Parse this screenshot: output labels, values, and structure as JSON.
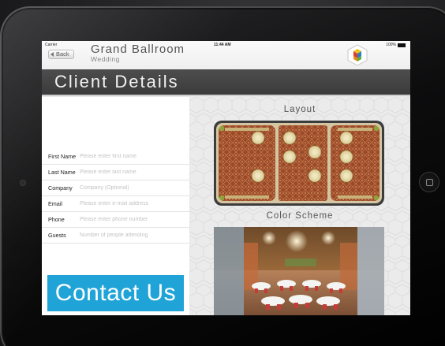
{
  "status_bar": {
    "carrier": "Carrier",
    "time": "11:44 AM",
    "battery": "100%"
  },
  "nav": {
    "back_label": "Back",
    "venue_title": "Grand Ballroom",
    "venue_subtitle": "Wedding"
  },
  "page": {
    "title": "Client Details"
  },
  "form": {
    "fields": [
      {
        "label": "First Name",
        "placeholder": "Please enter first name"
      },
      {
        "label": "Last Name",
        "placeholder": "Please enter last name"
      },
      {
        "label": "Company",
        "placeholder": "Company (Optional)"
      },
      {
        "label": "Email",
        "placeholder": "Please enter e-mail address"
      },
      {
        "label": "Phone",
        "placeholder": "Please enter phone number"
      },
      {
        "label": "Guests",
        "placeholder": "Number of people attending"
      }
    ],
    "contact_label": "Contact Us"
  },
  "right": {
    "layout_title": "Layout",
    "color_title": "Color Scheme"
  },
  "colors": {
    "accent": "#20a4d8",
    "header": "#444444",
    "carpet": "#9a4a2a"
  }
}
